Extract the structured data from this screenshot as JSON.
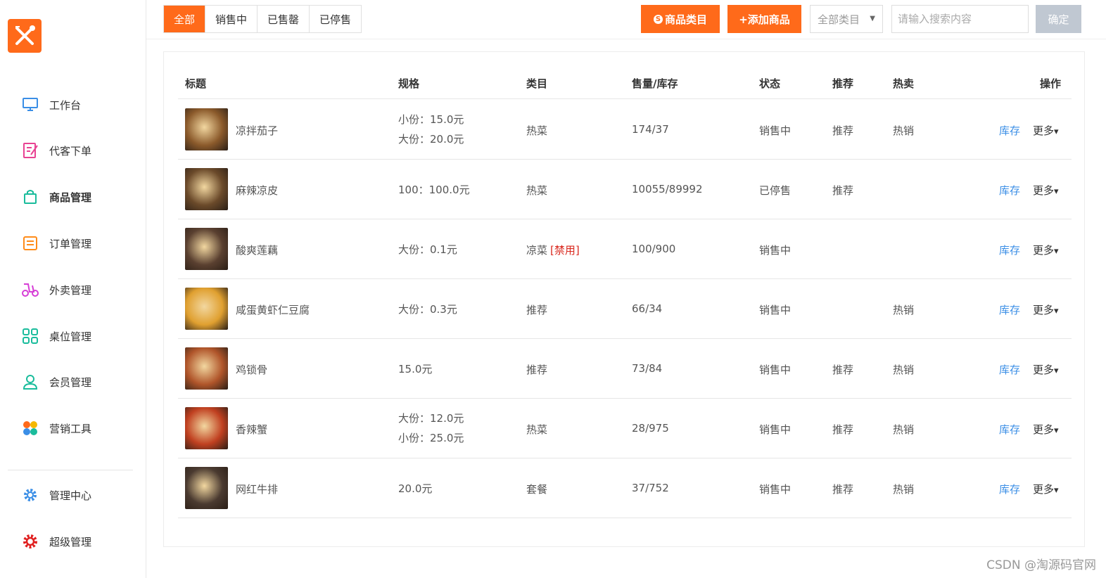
{
  "sidebar": {
    "items": [
      {
        "label": "工作台",
        "icon": "monitor-icon",
        "color": "#3a8ee6"
      },
      {
        "label": "代客下单",
        "icon": "edit-order-icon",
        "color": "#e84393"
      },
      {
        "label": "商品管理",
        "icon": "bag-icon",
        "color": "#1abc9c"
      },
      {
        "label": "订单管理",
        "icon": "list-icon",
        "color": "#ff8c1a"
      },
      {
        "label": "外卖管理",
        "icon": "scooter-icon",
        "color": "#d63dd6"
      },
      {
        "label": "桌位管理",
        "icon": "grid-icon",
        "color": "#1abc9c"
      },
      {
        "label": "会员管理",
        "icon": "user-icon",
        "color": "#1abc9c"
      },
      {
        "label": "营销工具",
        "icon": "clover-icon",
        "color": "#ff6a1a"
      },
      {
        "label": "管理中心",
        "icon": "gear-icon",
        "color": "#3a8ee6"
      },
      {
        "label": "超级管理",
        "icon": "gear-red-icon",
        "color": "#e02020"
      }
    ]
  },
  "toolbar": {
    "tabs": [
      "全部",
      "销售中",
      "已售罄",
      "已停售"
    ],
    "category_button": "商品类目",
    "add_button": "+添加商品",
    "select_value": "全部类目",
    "search_placeholder": "请输入搜索内容",
    "confirm_button": "确定"
  },
  "table": {
    "headers": {
      "title": "标题",
      "spec": "规格",
      "category": "类目",
      "sales_stock": "售量/库存",
      "status": "状态",
      "recommend": "推荐",
      "hot": "热卖",
      "actions": "操作"
    },
    "rows": [
      {
        "name": "凉拌茄子",
        "specs": [
          "小份：15.0元",
          "大份：20.0元"
        ],
        "category": "热菜",
        "category_tag": "",
        "sales_stock": "174/37",
        "status": "销售中",
        "recommend": "推荐",
        "hot": "热销",
        "thumb": "#8b5a2b"
      },
      {
        "name": "麻辣凉皮",
        "specs": [
          "100：100.0元"
        ],
        "category": "热菜",
        "category_tag": "",
        "sales_stock": "10055/89992",
        "status": "已停售",
        "recommend": "推荐",
        "hot": "",
        "thumb": "#6b4a2a"
      },
      {
        "name": "酸爽莲藕",
        "specs": [
          "大份：0.1元"
        ],
        "category": "凉菜",
        "category_tag": "[禁用]",
        "sales_stock": "100/900",
        "status": "销售中",
        "recommend": "",
        "hot": "",
        "thumb": "#5a4030"
      },
      {
        "name": "咸蛋黄虾仁豆腐",
        "specs": [
          "大份：0.3元"
        ],
        "category": "推荐",
        "category_tag": "",
        "sales_stock": "66/34",
        "status": "销售中",
        "recommend": "",
        "hot": "热销",
        "thumb": "#e0a030"
      },
      {
        "name": "鸡锁骨",
        "specs": [
          "15.0元"
        ],
        "category": "推荐",
        "category_tag": "",
        "sales_stock": "73/84",
        "status": "销售中",
        "recommend": "推荐",
        "hot": "热销",
        "thumb": "#b0552a"
      },
      {
        "name": "香辣蟹",
        "specs": [
          "大份：12.0元",
          "小份：25.0元"
        ],
        "category": "热菜",
        "category_tag": "",
        "sales_stock": "28/975",
        "status": "销售中",
        "recommend": "推荐",
        "hot": "热销",
        "thumb": "#c04020"
      },
      {
        "name": "网红牛排",
        "specs": [
          "20.0元"
        ],
        "category": "套餐",
        "category_tag": "",
        "sales_stock": "37/752",
        "status": "销售中",
        "recommend": "推荐",
        "hot": "热销",
        "thumb": "#4a3a30"
      }
    ],
    "stock_link": "库存",
    "more_label": "更多"
  },
  "watermark": "CSDN @淘源码官网",
  "colors": {
    "accent": "#ff6a1a",
    "link": "#3a8ee6",
    "disabled": "#d9281e"
  }
}
